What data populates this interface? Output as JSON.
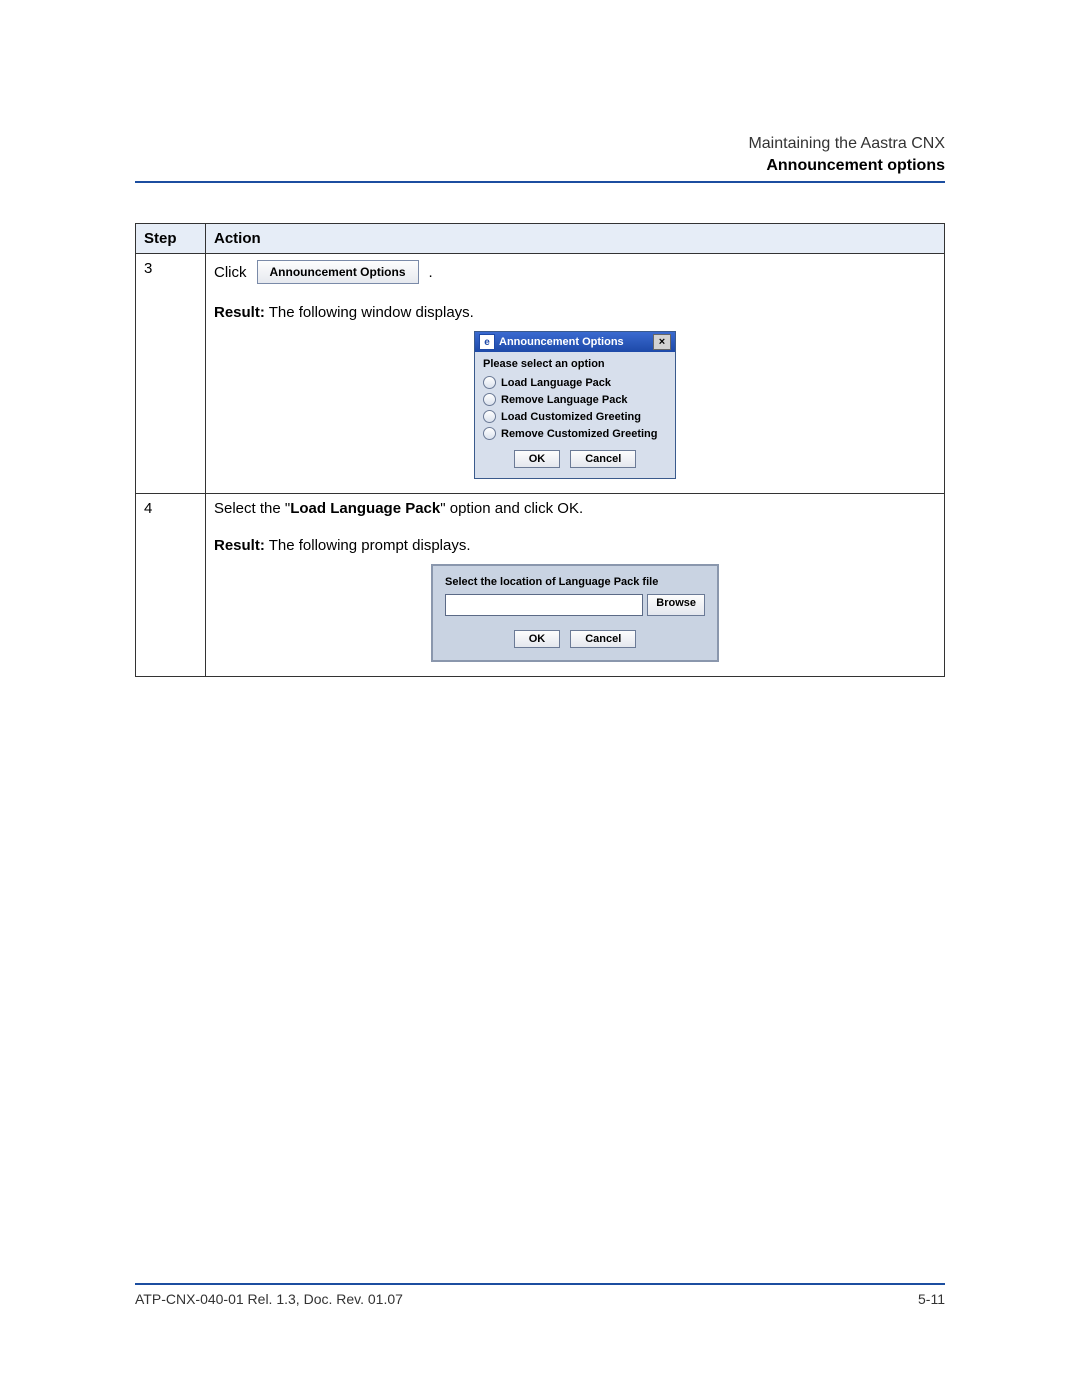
{
  "header": {
    "breadcrumb": "Maintaining the Aastra CNX",
    "section_title": "Announcement options"
  },
  "table": {
    "headers": {
      "step": "Step",
      "action": "Action"
    },
    "row3": {
      "step": "3",
      "click_word": "Click",
      "button_label": "Announcement Options",
      "trailing": ".",
      "result_label": "Result:",
      "result_text": " The following window displays.",
      "dialog": {
        "title": "Announcement Options",
        "prompt": "Please select an option",
        "options": [
          "Load Language Pack",
          "Remove Language Pack",
          "Load Customized Greeting",
          "Remove Customized Greeting"
        ],
        "ok": "OK",
        "cancel": "Cancel"
      }
    },
    "row4": {
      "step": "4",
      "instruction_pre": "Select the \"",
      "instruction_bold": "Load Language Pack",
      "instruction_post": "\" option and click OK.",
      "result_label": "Result:",
      "result_text": " The following prompt displays.",
      "dialog": {
        "prompt": "Select the location of Language Pack file",
        "browse": "Browse",
        "ok": "OK",
        "cancel": "Cancel"
      }
    }
  },
  "footer": {
    "doc_id": "ATP-CNX-040-01 Rel. 1.3, Doc. Rev. 01.07",
    "page_num": "5-11"
  }
}
